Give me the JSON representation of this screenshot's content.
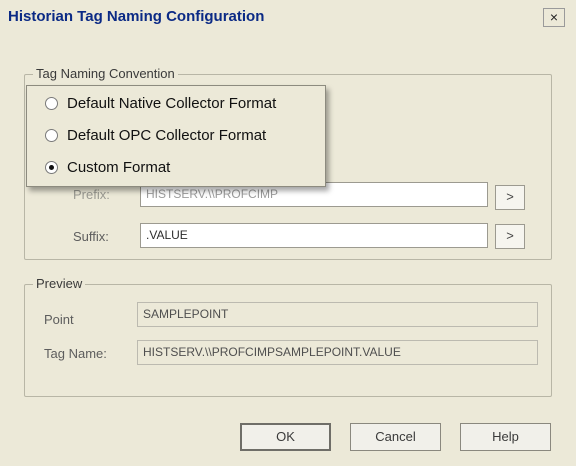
{
  "dialog": {
    "title": "Historian Tag Naming Configuration",
    "close_glyph": "×"
  },
  "tag_naming": {
    "group_label": "Tag Naming Convention",
    "options": [
      {
        "label": "Default Native Collector Format",
        "checked": false
      },
      {
        "label": "Default OPC Collector Format",
        "checked": false
      },
      {
        "label": "Custom Format",
        "checked": true
      }
    ],
    "prefix": {
      "label": "Prefix:",
      "value": "HISTSERV.\\\\PROFCIMP",
      "button": ">"
    },
    "suffix": {
      "label": "Suffix:",
      "value": ".VALUE",
      "button": ">"
    }
  },
  "preview": {
    "group_label": "Preview",
    "point": {
      "label": "Point",
      "value": "SAMPLEPOINT"
    },
    "tag_name": {
      "label": "Tag Name:",
      "value": "HISTSERV.\\\\PROFCIMPSAMPLEPOINT.VALUE"
    }
  },
  "buttons": {
    "ok": "OK",
    "cancel": "Cancel",
    "help": "Help"
  },
  "colors": {
    "dialog_bg": "#ece9d8",
    "title_text": "#0b2a85"
  }
}
